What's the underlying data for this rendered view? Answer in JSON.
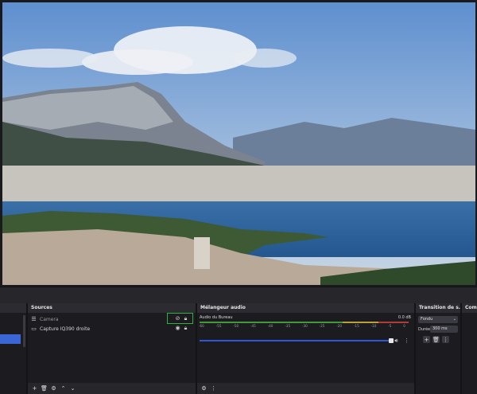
{
  "preview": {
    "image_description_name": "toulon-bay-preview"
  },
  "scenes": {
    "selected_index": 0
  },
  "sources": {
    "title": "Sources",
    "items": [
      {
        "label": "Camera",
        "icon": "list-icon",
        "visible": false,
        "locked": true
      },
      {
        "label": "Capture IQ390 droite",
        "icon": "monitor-icon",
        "visible": true,
        "locked": true
      }
    ]
  },
  "mixer": {
    "title": "Mélangeur audio",
    "channel_name": "Audio du Bureau",
    "level": "0.0 dB",
    "ticks": [
      "-60",
      "-55",
      "-50",
      "-45",
      "-40",
      "-35",
      "-30",
      "-25",
      "-20",
      "-15",
      "-10",
      "-5",
      "0"
    ]
  },
  "transition": {
    "title": "Transition de s...",
    "type": "Fondu",
    "duration_label": "Durée",
    "duration_value": "300 ms"
  },
  "controls": {
    "title": "Comm"
  },
  "colors": {
    "accent": "#3b66d6",
    "highlight": "#2fb23a",
    "meter_green": "#3f9a3a",
    "meter_yellow": "#b8a03a",
    "meter_red": "#b33a3a"
  }
}
